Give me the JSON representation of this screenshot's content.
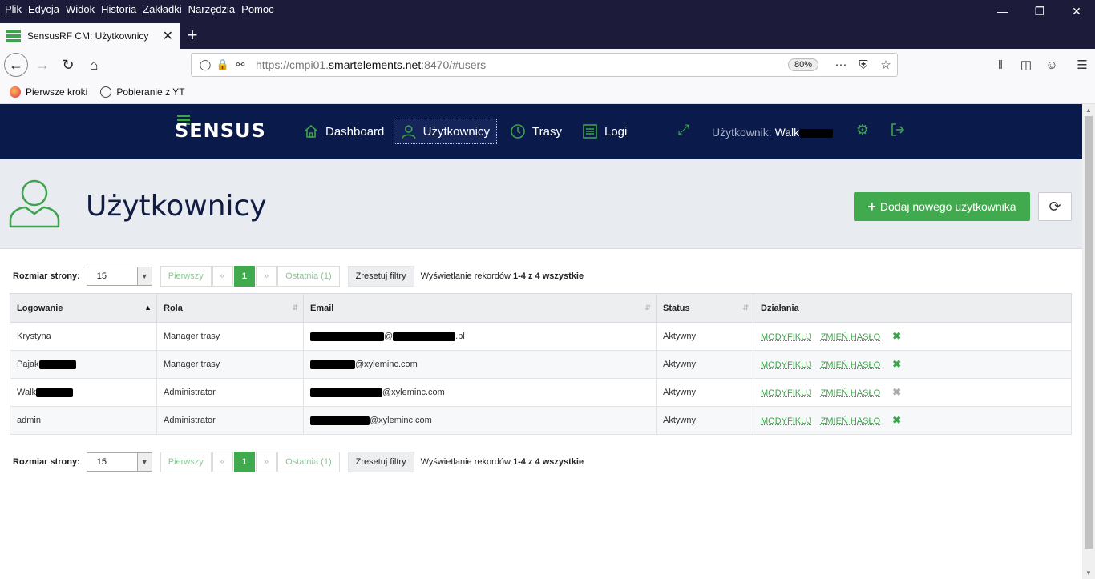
{
  "browser": {
    "menu": [
      "Plik",
      "Edycja",
      "Widok",
      "Historia",
      "Zakładki",
      "Narzędzia",
      "Pomoc"
    ],
    "tab_title": "SensusRF CM: Użytkownicy",
    "url_prefix": "https://cmpi01.",
    "url_domain": "smartelements.net",
    "url_suffix": ":8470/#users",
    "zoom": "80%",
    "bookmarks": [
      "Pierwsze kroki",
      "Pobieranie z YT"
    ]
  },
  "app": {
    "logo": "SENSUS",
    "nav": {
      "dashboard": "Dashboard",
      "users": "Użytkownicy",
      "routes": "Trasy",
      "logs": "Logi"
    },
    "user_label": "Użytkownik:",
    "user_name": "Walk"
  },
  "page": {
    "title": "Użytkownicy",
    "add_button": "Dodaj nowego użytkownika"
  },
  "pager": {
    "size_label": "Rozmiar strony:",
    "size_value": "15",
    "first": "Pierwszy",
    "prev": "«",
    "current": "1",
    "next": "»",
    "last": "Ostatnia (1)",
    "reset": "Zresetuj filtry",
    "info_prefix": "Wyświetlanie rekordów",
    "info_range": "1-4 z 4 wszystkie"
  },
  "table": {
    "headers": [
      "Logowanie",
      "Rola",
      "Email",
      "Status",
      "Działania"
    ],
    "rows": [
      {
        "login": "Krystyna",
        "role": "Manager trasy",
        "email_mid": "@",
        "email_end": ".pl",
        "status": "Aktywny"
      },
      {
        "login": "Pajak",
        "role": "Manager trasy",
        "email_end": "@xyleminc.com",
        "status": "Aktywny"
      },
      {
        "login": "Walk",
        "role": "Administrator",
        "email_end": "@xyleminc.com",
        "status": "Aktywny"
      },
      {
        "login": "admin",
        "role": "Administrator",
        "email_end": "@xyleminc.com",
        "status": "Aktywny"
      }
    ],
    "action_modify": "MODYFIKUJ",
    "action_password": "ZMIEŃ HASŁO"
  }
}
